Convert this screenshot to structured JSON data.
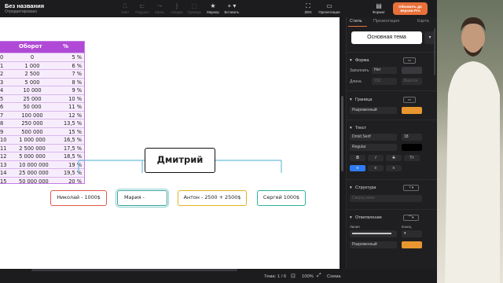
{
  "topbar": {
    "title": "Без названия",
    "subtitle": "Отредактировано",
    "buttons": [
      {
        "label": "Узел",
        "icon": "node-icon",
        "active": false
      },
      {
        "label": "Подузел",
        "icon": "subnode-icon",
        "active": false
      },
      {
        "label": "Связь",
        "icon": "link-icon",
        "active": false
      },
      {
        "label": "Сводка",
        "icon": "summary-icon",
        "active": false
      },
      {
        "label": "Граница",
        "icon": "boundary-icon",
        "active": false
      },
      {
        "label": "Маркер",
        "icon": "marker-icon",
        "active": true
      },
      {
        "label": "Вставить",
        "icon": "plus-icon",
        "active": true
      },
      {
        "label": "ZEN",
        "icon": "zen-icon",
        "active": true
      },
      {
        "label": "Презентация",
        "icon": "presentation-icon",
        "active": true
      },
      {
        "label": "Формат",
        "icon": "format-icon",
        "active": true
      }
    ],
    "pro_button": "Обновить до версии Pro"
  },
  "table": {
    "headers": [
      "",
      "Оборот",
      "%"
    ],
    "rows": [
      [
        "0",
        "0",
        "5 %"
      ],
      [
        "1",
        "1 000",
        "6 %"
      ],
      [
        "2",
        "2 500",
        "7 %"
      ],
      [
        "3",
        "5 000",
        "8 %"
      ],
      [
        "4",
        "10 000",
        "9 %"
      ],
      [
        "5",
        "25 000",
        "10 %"
      ],
      [
        "6",
        "50 000",
        "11 %"
      ],
      [
        "7",
        "100 000",
        "12 %"
      ],
      [
        "8",
        "250 000",
        "13,5 %"
      ],
      [
        "9",
        "500 000",
        "15 %"
      ],
      [
        "10",
        "1 000 000",
        "16,5 %"
      ],
      [
        "11",
        "2 500 000",
        "17,5 %"
      ],
      [
        "12",
        "5 000 000",
        "18,5 %"
      ],
      [
        "13",
        "10 000 000",
        "19 %"
      ],
      [
        "14",
        "25 000 000",
        "19,5 %"
      ],
      [
        "15",
        "50 000 000",
        "20 %"
      ]
    ]
  },
  "mindmap": {
    "root": "Дмитрий",
    "children": [
      "Николай - 1000$",
      "Мария -",
      "Антон - 2500 + 2500$",
      "Сергей 1000$"
    ],
    "colors": {
      "line": "#6fbdd9",
      "nikolai": "#e05a4a",
      "maria": "#3aa3a0",
      "anton": "#e0b422",
      "sergei": "#2fb39a"
    }
  },
  "statusbar": {
    "theme": "Тема: 1 / 6",
    "zoom": "100%",
    "scheme": "Схема"
  },
  "panel": {
    "tabs": [
      "Стиль",
      "Презентация",
      "Карта"
    ],
    "active_tab": "Стиль",
    "theme_name": "Основная тема",
    "shape": {
      "title": "Форма",
      "fill_label": "Заполнить",
      "fill_value": "Нет",
      "length_label": "Длина",
      "length_value": "152",
      "length_placeholder": "Высота"
    },
    "border": {
      "title": "Граница",
      "style": "Разреженный",
      "color": "#e8962f"
    },
    "text": {
      "title": "Текст",
      "font": "Droid Serif",
      "size": "18",
      "weight": "Regular",
      "color": "#000000",
      "bold": "B",
      "italic": "I",
      "strike": "S",
      "case": "Tт"
    },
    "structure": {
      "title": "Структура",
      "direction": "Сверху вниз"
    },
    "branch": {
      "title": "Ответвление",
      "line_label": "Линия",
      "end_label": "Конец",
      "style": "Разреженный",
      "color": "#e8962f"
    }
  }
}
